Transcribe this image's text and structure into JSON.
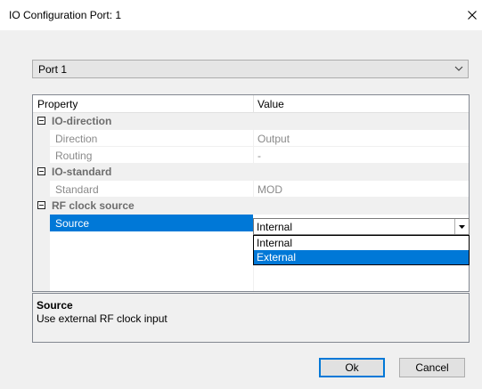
{
  "window": {
    "title": "IO Configuration Port: 1"
  },
  "port_select": {
    "value": "Port 1"
  },
  "grid": {
    "headers": {
      "property": "Property",
      "value": "Value"
    },
    "categories": [
      {
        "label": "IO-direction",
        "properties": [
          {
            "name": "Direction",
            "value": "Output"
          },
          {
            "name": "Routing",
            "value": "-"
          }
        ]
      },
      {
        "label": "IO-standard",
        "properties": [
          {
            "name": "Standard",
            "value": "MOD"
          }
        ]
      },
      {
        "label": "RF clock source",
        "properties": [
          {
            "name": "Source",
            "value": "Internal"
          }
        ]
      }
    ]
  },
  "source_dropdown": {
    "current": "Internal",
    "options": [
      "Internal",
      "External"
    ],
    "highlighted": "External"
  },
  "description": {
    "title": "Source",
    "text": "Use external RF clock input"
  },
  "buttons": {
    "ok": "Ok",
    "cancel": "Cancel"
  },
  "colors": {
    "selection": "#0078d7",
    "dialog_bg": "#f0f0f0",
    "category_text": "#6d6d6d",
    "readonly_text": "#8a8a8a"
  },
  "icons": {
    "close": "close-icon",
    "combo_arrow": "chevron-down-icon",
    "value_dropdown_arrow": "triangle-down-icon",
    "category_toggle": "collapse-minus-icon"
  }
}
